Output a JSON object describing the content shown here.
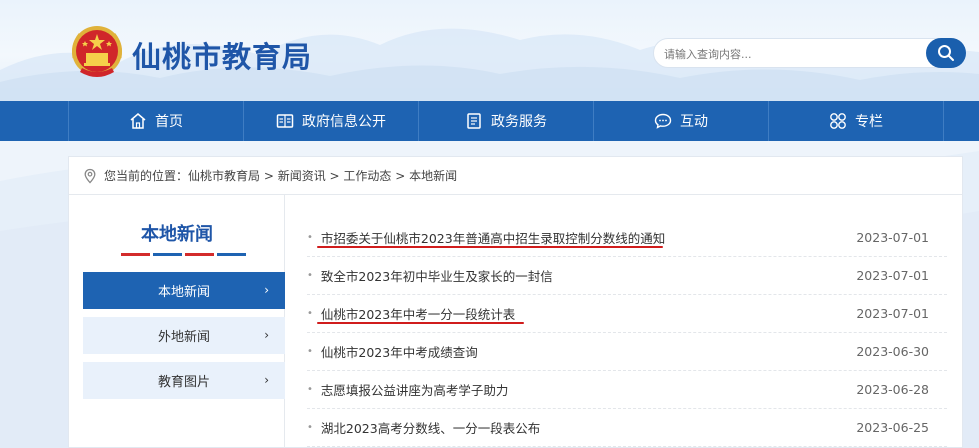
{
  "header": {
    "site_title": "仙桃市教育局",
    "search_placeholder": "请输入查询内容..."
  },
  "nav": [
    {
      "label": "首页",
      "icon": "home-icon"
    },
    {
      "label": "政府信息公开",
      "icon": "info-panel-icon"
    },
    {
      "label": "政务服务",
      "icon": "document-icon"
    },
    {
      "label": "互动",
      "icon": "chat-icon"
    },
    {
      "label": "专栏",
      "icon": "grid-icon"
    }
  ],
  "breadcrumb": {
    "prefix": "您当前的位置：",
    "items": [
      "仙桃市教育局",
      "新闻资讯",
      "工作动态",
      "本地新闻"
    ],
    "separator": " > "
  },
  "sidebar": {
    "title": "本地新闻",
    "items": [
      {
        "label": "本地新闻",
        "active": true
      },
      {
        "label": "外地新闻",
        "active": false
      },
      {
        "label": "教育图片",
        "active": false
      }
    ],
    "chevron": "›"
  },
  "news": [
    {
      "title": "市招委关于仙桃市2023年普通高中招生录取控制分数线的通知",
      "date": "2023-07-01",
      "underlined": true
    },
    {
      "title": "致全市2023年初中毕业生及家长的一封信",
      "date": "2023-07-01",
      "underlined": false
    },
    {
      "title": "仙桃市2023年中考一分一段统计表",
      "date": "2023-07-01",
      "underlined": true
    },
    {
      "title": "仙桃市2023年中考成绩查询",
      "date": "2023-06-30",
      "underlined": false
    },
    {
      "title": "志愿填报公益讲座为高考学子助力",
      "date": "2023-06-28",
      "underlined": false
    },
    {
      "title": "湖北2023高考分数线、一分一段表公布",
      "date": "2023-06-25",
      "underlined": false
    }
  ],
  "colors": {
    "brand_blue": "#1e63b2",
    "title_blue": "#1f56a8",
    "annotation_red": "#d01c1c"
  }
}
